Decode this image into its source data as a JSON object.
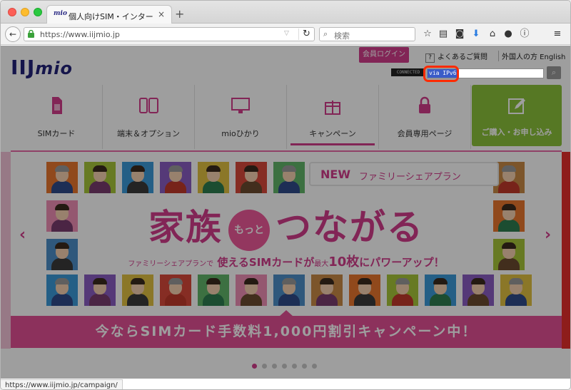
{
  "browser": {
    "tab_title": "個人向けSIM・インターネッ…",
    "tab_favicon_text": "mio",
    "url": "https://www.iijmio.jp",
    "search_placeholder": "検索",
    "status_url": "https://www.iijmio.jp/campaign/"
  },
  "header": {
    "logo_main": "IIJ",
    "logo_sub": "mio",
    "login": "会員ログイン",
    "faq": "よくあるご質問",
    "faq_icon": "?",
    "foreign": "外国人の方 English",
    "connected": "CONNECTED",
    "via": "via IPv6"
  },
  "nav": [
    {
      "label": "SIMカード",
      "icon": "sim-card-icon"
    },
    {
      "label": "端末＆オプション",
      "icon": "device-icon"
    },
    {
      "label": "mioひかり",
      "icon": "monitor-icon"
    },
    {
      "label": "キャンペーン",
      "icon": "gift-icon"
    },
    {
      "label": "会員専用ページ",
      "icon": "lock-icon"
    },
    {
      "label": "ご購入・お申し込み",
      "icon": "edit-icon"
    }
  ],
  "banner": {
    "new_label": "NEW",
    "plan_label": "ファミリーシェアプラン",
    "title_left": "家族",
    "title_badge": "もっと",
    "title_right": "つながる",
    "sub_small1": "ファミリーシェアプランで",
    "sub_big1": "使えるSIMカードが",
    "sub_small2": "最大",
    "sub_big2": "10枚",
    "sub_big3": "にパワーアップ！",
    "ribbon": "今ならSIMカード手数料1,000円割引キャンペーン中！",
    "prev_arrow": "‹",
    "next_arrow": "›"
  },
  "colors": {
    "brand_pink": "#d23c8c",
    "buy_green": "#8bc23a",
    "highlight": "#ff2a00"
  }
}
